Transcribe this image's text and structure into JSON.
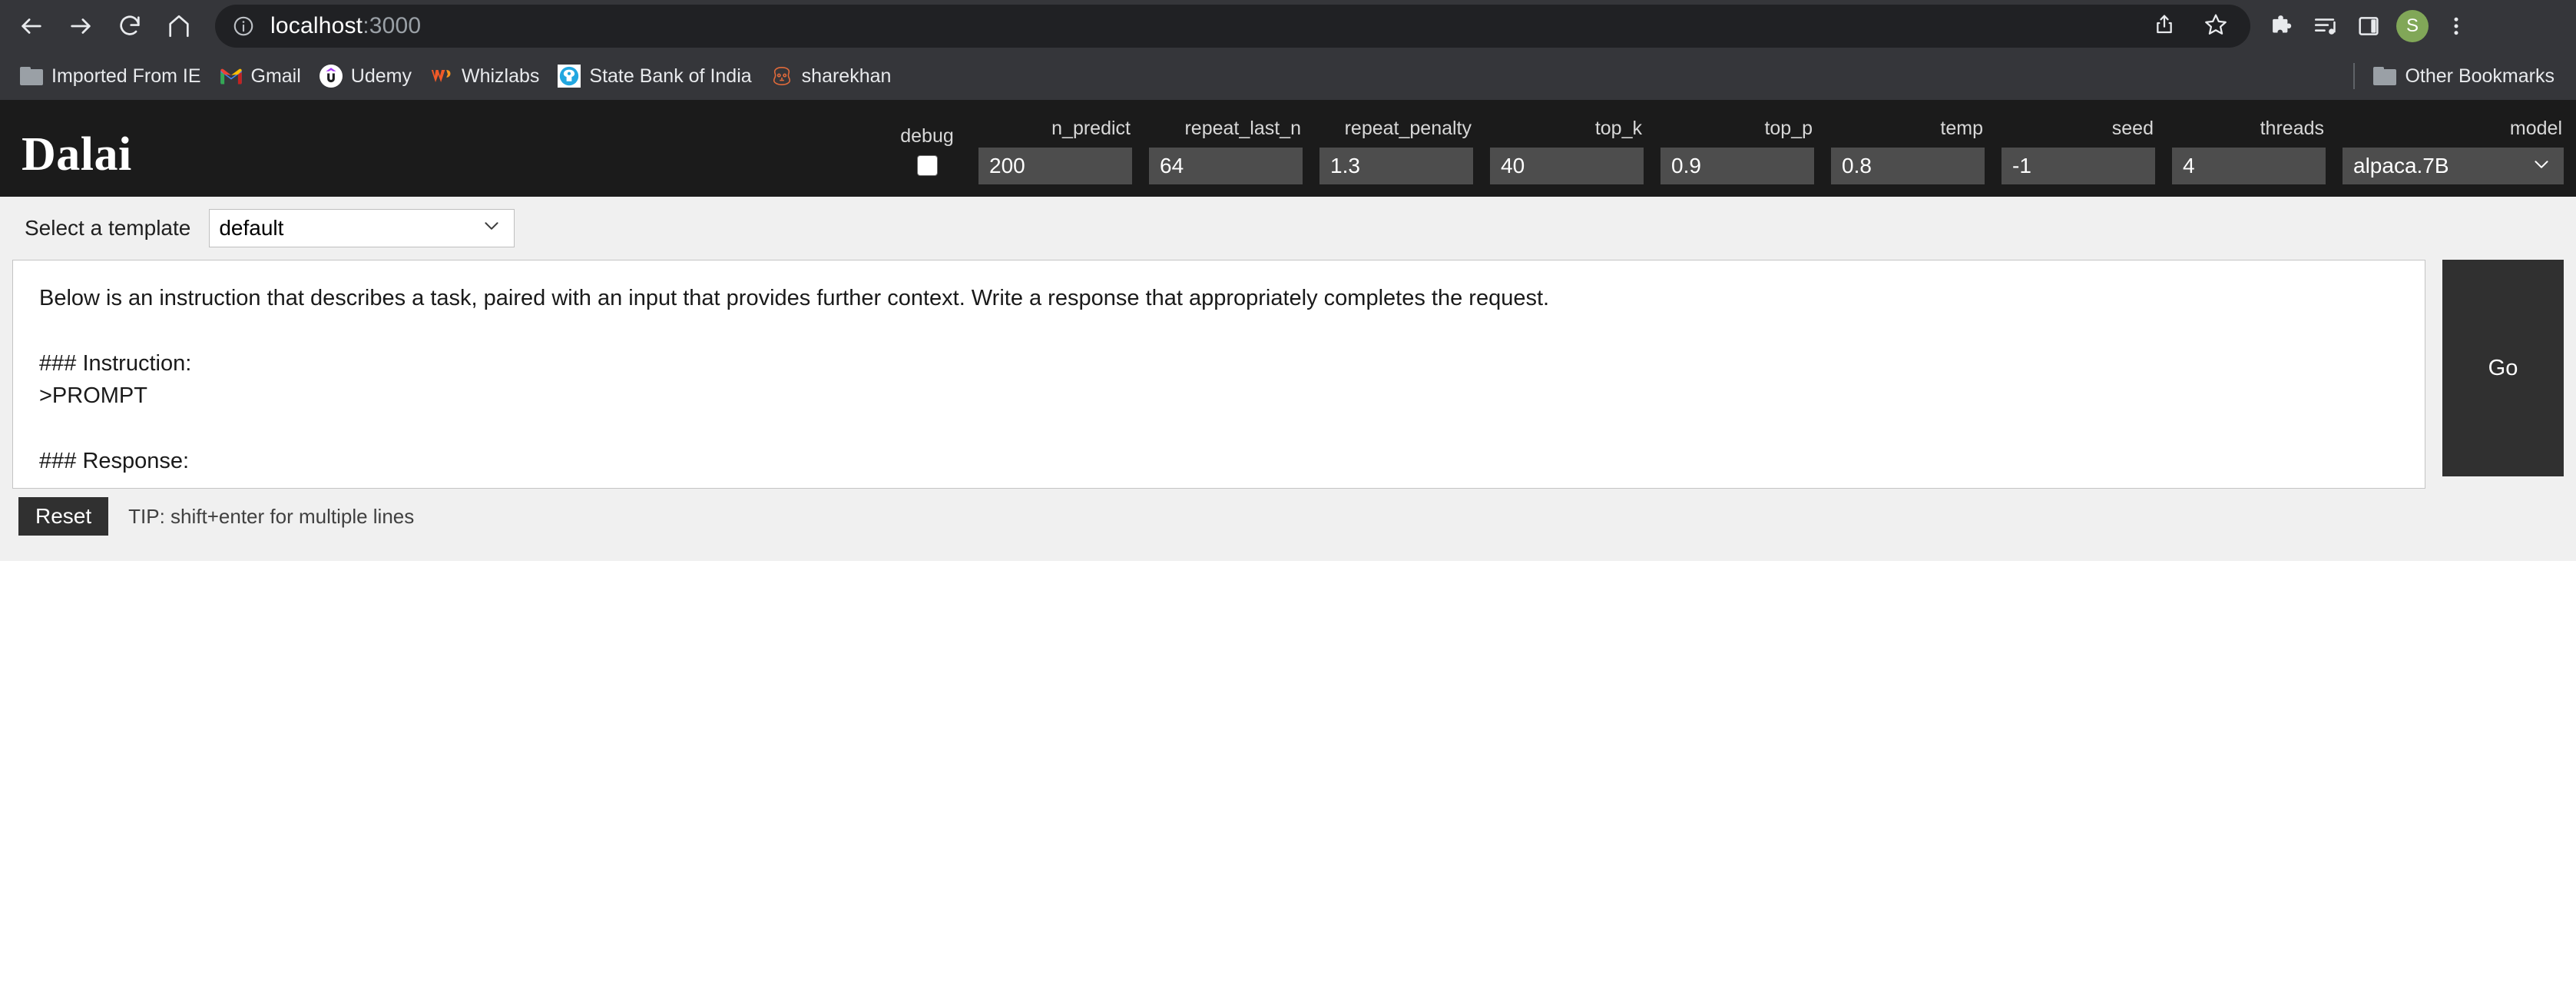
{
  "browser": {
    "nav": {
      "back": "back-arrow",
      "forward": "forward-arrow",
      "reload": "reload",
      "home": "home"
    },
    "omnibox": {
      "info_icon": "site-information-icon",
      "host": "localhost",
      "port": ":3000",
      "share_icon": "share-icon",
      "bookmark_icon": "bookmark-star-icon"
    },
    "toolbar_right": {
      "extensions_icon": "extensions-puzzle-icon",
      "media_icon": "media-playlist-icon",
      "sidepanel_icon": "side-panel-icon",
      "profile_initial": "S",
      "menu_icon": "three-dot-menu-icon"
    },
    "bookmarks": [
      {
        "label": "Imported From IE",
        "icon": "folder-icon"
      },
      {
        "label": "Gmail",
        "icon": "gmail-icon"
      },
      {
        "label": "Udemy",
        "icon": "udemy-icon"
      },
      {
        "label": "Whizlabs",
        "icon": "whizlabs-icon"
      },
      {
        "label": "State Bank of India",
        "icon": "sbi-icon"
      },
      {
        "label": "sharekhan",
        "icon": "sharekhan-icon"
      }
    ],
    "other_bookmarks": {
      "label": "Other Bookmarks",
      "icon": "folder-icon"
    }
  },
  "app": {
    "logo": "Dalai",
    "params": [
      {
        "label": "debug",
        "type": "checkbox",
        "value": "",
        "checked": false
      },
      {
        "label": "n_predict",
        "type": "text",
        "value": "200"
      },
      {
        "label": "repeat_last_n",
        "type": "text",
        "value": "64"
      },
      {
        "label": "repeat_penalty",
        "type": "text",
        "value": "1.3"
      },
      {
        "label": "top_k",
        "type": "text",
        "value": "40"
      },
      {
        "label": "top_p",
        "type": "text",
        "value": "0.9"
      },
      {
        "label": "temp",
        "type": "text",
        "value": "0.8"
      },
      {
        "label": "seed",
        "type": "text",
        "value": "-1"
      },
      {
        "label": "threads",
        "type": "text",
        "value": "4"
      },
      {
        "label": "model",
        "type": "select",
        "value": "alpaca.7B"
      }
    ],
    "template": {
      "label": "Select a template",
      "value": "default"
    },
    "prompt": "Below is an instruction that describes a task, paired with an input that provides further context. Write a response that appropriately completes the request.\n\n### Instruction:\n>PROMPT\n\n### Response:",
    "go_label": "Go",
    "reset_label": "Reset",
    "tip": "TIP: shift+enter for multiple lines"
  }
}
